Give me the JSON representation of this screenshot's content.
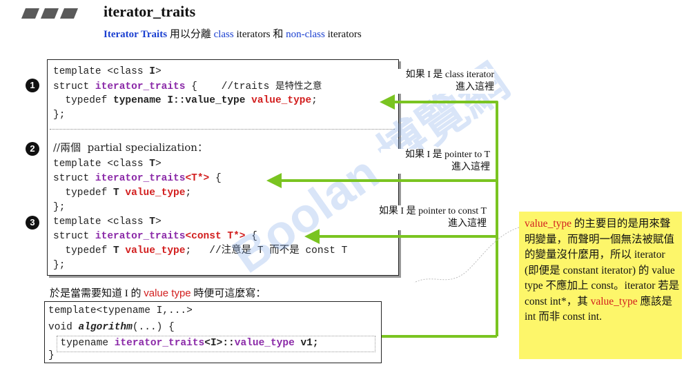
{
  "header": {
    "title": "iterator_traits",
    "subtitle": {
      "part1": "Iterator Traits",
      "part2": " 用以分離 ",
      "part3": "class",
      "part4": " iterators 和 ",
      "part5": "non-class",
      "part6": " iterators"
    }
  },
  "markers": [
    "1",
    "2",
    "3"
  ],
  "code": {
    "l1": {
      "a": "template <class ",
      "b": "I",
      "c": ">"
    },
    "l2": {
      "a": "struct ",
      "b": "iterator_traits",
      "c": " {    //traits ",
      "d": "是特性之意"
    },
    "l3": {
      "a": "  typedef ",
      "b": "typename I::value_type ",
      "c": "value_type",
      "d": ";"
    },
    "l4": "};",
    "l5": {
      "a": "//兩個  partial specialization："
    },
    "l6": {
      "a": "template <class ",
      "b": "T",
      "c": ">"
    },
    "l7": {
      "a": "struct ",
      "b": "iterator_traits",
      "c": "<T*>",
      "d": " {"
    },
    "l8": {
      "a": "  typedef ",
      "b": "T ",
      "c": "value_type",
      "d": ";"
    },
    "l9": "};",
    "l10": {
      "a": "template <class ",
      "b": "T",
      "c": ">"
    },
    "l11": {
      "a": "struct ",
      "b": "iterator_traits",
      "c": "<const T*>",
      "d": " {"
    },
    "l12": {
      "a": "  typedef ",
      "b": "T ",
      "c": "value_type",
      "d": ";   //注意是 T 而不是 const T"
    },
    "l13": "};"
  },
  "notes": {
    "n1a": "如果 I 是 class iterator",
    "n1b": "進入這裡",
    "n2a": "如果 I 是 pointer to T",
    "n2b": "進入這裡",
    "n3a": "如果 I 是 pointer to const T",
    "n3b": "進入這裡"
  },
  "explanation": {
    "t1": "value_type",
    "t2": " 的主要目的是用來聲明變量，而聲明一個無法被賦值的變量沒什麼用，所以 iterator (即便是 constant iterator) 的 value type 不應加上 const。iterator 若是 const int*，其 ",
    "t3": "value_type",
    "t4": " 應該是 int 而非 const int."
  },
  "bottom": {
    "label_a": "於是當需要知道 I 的 ",
    "label_b": "value type",
    "label_c": " 時便可這麼寫：",
    "c1": "template<typename I,...>",
    "c2a": "void ",
    "c2b": "algorithm",
    "c2c": "(...) {",
    "c3a": "  typename ",
    "c3b": "iterator_traits",
    "c3c": "<I>::",
    "c3d": "value_type",
    "c3e": " v1;",
    "c4": "}"
  },
  "watermark": "Boolan 博覽網",
  "colors": {
    "arrow": "#7ac421",
    "highlight": "#fdf66a",
    "keyword": "#8b2aa8",
    "type": "#d21e1e"
  }
}
